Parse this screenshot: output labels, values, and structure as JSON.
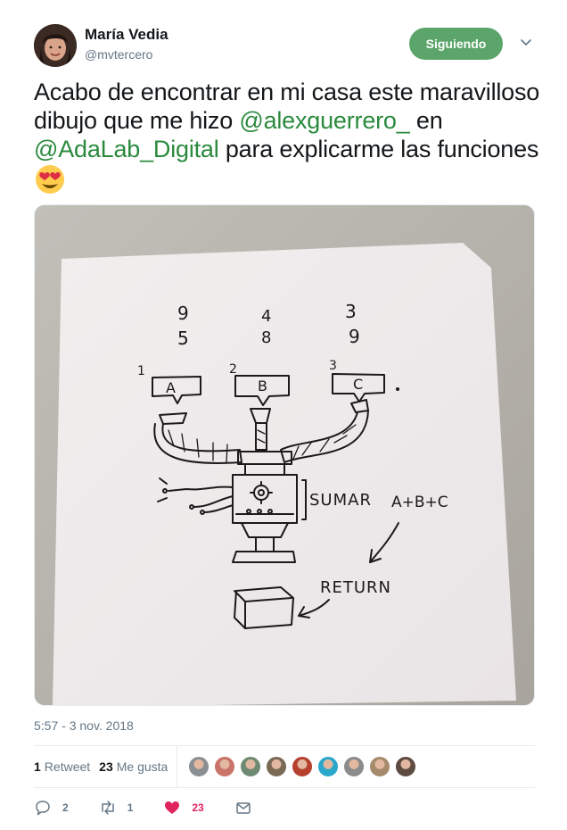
{
  "author": {
    "name": "María Vedia",
    "handle": "@mvtercero",
    "follow_label": "Siguiendo"
  },
  "tweet": {
    "text_1": "Acabo de encontrar en mi casa este maravilloso dibujo que me hizo ",
    "mention_1": "@alexguerrero_",
    "text_2": " en ",
    "mention_2": "@AdaLab_Digital",
    "text_3": " para explicarme las funciones ",
    "emoji": "heart-eyes-emoji"
  },
  "drawing": {
    "numbers_a": [
      "9",
      "5"
    ],
    "numbers_b": [
      "4",
      "8"
    ],
    "numbers_c": [
      "3",
      "9"
    ],
    "index_a": "1",
    "index_b": "2",
    "index_c": "3",
    "label_a": "A",
    "label_b": "B",
    "label_c": "C",
    "sumar": "SUMAR",
    "formula": "A+B+C",
    "return_label": "RETURN"
  },
  "timestamp": "5:57 - 3 nov. 2018",
  "stats": {
    "retweets_count": "1",
    "retweets_label": "Retweet",
    "likes_count": "23",
    "likes_label": "Me gusta"
  },
  "likers": [
    "#8a8f94",
    "#c9736a",
    "#6f8a72",
    "#7a6a55",
    "#b6402e",
    "#2aa7c9",
    "#8b8b8b",
    "#a58a6c",
    "#5e4b42"
  ],
  "actions": {
    "reply_count": "2",
    "retweet_count": "1",
    "like_count": "23"
  },
  "colors": {
    "accent": "#2b8a3e",
    "follow_button": "#5ba56a",
    "like": "#e0245e"
  }
}
